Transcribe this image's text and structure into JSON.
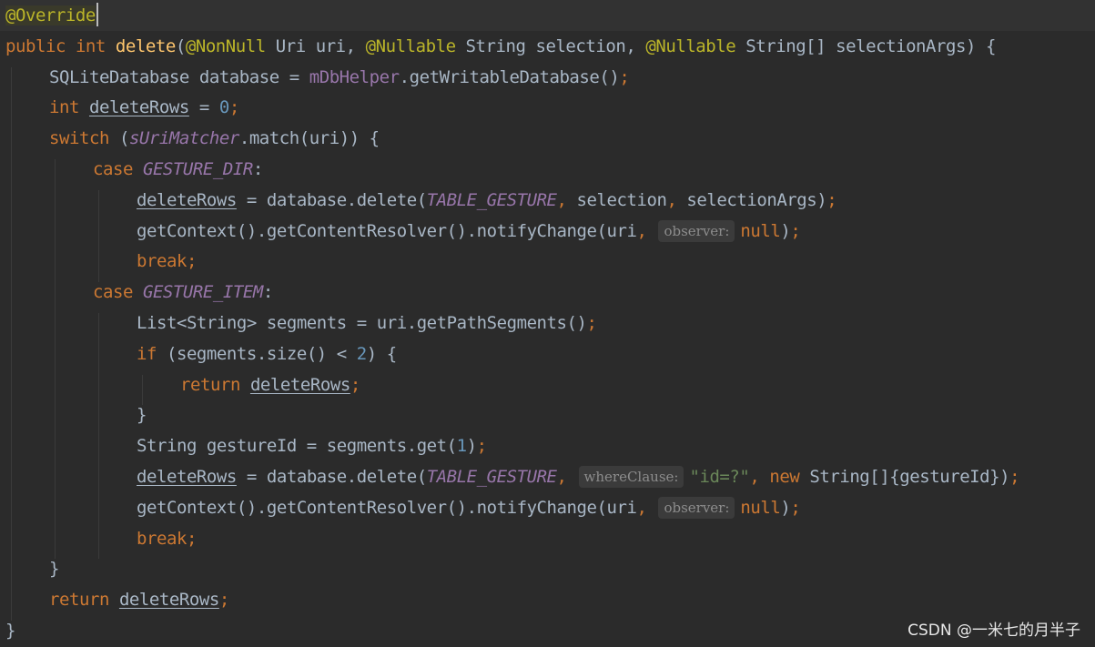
{
  "theme": {
    "background": "#2b2b2b",
    "current_line": "#323232",
    "default_text": "#a9b7c6",
    "keyword": "#cc7832",
    "annotation": "#bbb529",
    "method": "#ffc66d",
    "field": "#9876aa",
    "number": "#6897bb",
    "string": "#6a8759",
    "hint_bg": "#3b3b3b",
    "hint_text": "#8c8c8c"
  },
  "code_lines": [
    {
      "indent": 0,
      "current": true,
      "tokens": [
        {
          "t": "@Override",
          "c": "ann-hl"
        },
        {
          "caret": true
        }
      ]
    },
    {
      "indent": 0,
      "tokens": [
        {
          "t": "public ",
          "c": "kw"
        },
        {
          "t": "int ",
          "c": "kw"
        },
        {
          "t": "delete",
          "c": "fn"
        },
        {
          "t": "("
        },
        {
          "t": "@NonNull ",
          "c": "ann"
        },
        {
          "t": "Uri uri, "
        },
        {
          "t": "@Nullable ",
          "c": "ann"
        },
        {
          "t": "String selection, "
        },
        {
          "t": "@Nullable ",
          "c": "ann"
        },
        {
          "t": "String[] selectionArgs) {"
        }
      ]
    },
    {
      "indent": 1,
      "tokens": [
        {
          "t": "SQLiteDatabase database = "
        },
        {
          "t": "mDbHelper",
          "c": "fld"
        },
        {
          "t": ".getWritableDatabase()"
        },
        {
          "t": ";",
          "c": "kw"
        }
      ]
    },
    {
      "indent": 1,
      "tokens": [
        {
          "t": "int ",
          "c": "kw"
        },
        {
          "t": "deleteRows",
          "c": "uline"
        },
        {
          "t": " = "
        },
        {
          "t": "0",
          "c": "num"
        },
        {
          "t": ";",
          "c": "kw"
        }
      ]
    },
    {
      "indent": 1,
      "tokens": [
        {
          "t": "switch ",
          "c": "kw"
        },
        {
          "t": "("
        },
        {
          "t": "sUriMatcher",
          "c": "sfld"
        },
        {
          "t": ".match(uri)) {"
        }
      ]
    },
    {
      "indent": 2,
      "tokens": [
        {
          "t": "case ",
          "c": "kw"
        },
        {
          "t": "GESTURE_DIR",
          "c": "sfld"
        },
        {
          "t": ":"
        }
      ]
    },
    {
      "indent": 3,
      "tokens": [
        {
          "t": "deleteRows",
          "c": "uline"
        },
        {
          "t": " = database.delete("
        },
        {
          "t": "TABLE_GESTURE",
          "c": "sfld"
        },
        {
          "t": ", ",
          "c": "kw"
        },
        {
          "t": "selection"
        },
        {
          "t": ", ",
          "c": "kw"
        },
        {
          "t": "selectionArgs)"
        },
        {
          "t": ";",
          "c": "kw"
        }
      ]
    },
    {
      "indent": 3,
      "tokens": [
        {
          "t": "getContext().getContentResolver().notifyChange(uri"
        },
        {
          "t": ", ",
          "c": "kw"
        },
        {
          "hint": "observer:"
        },
        {
          "t": "null",
          "c": "kw"
        },
        {
          "t": ")"
        },
        {
          "t": ";",
          "c": "kw"
        }
      ]
    },
    {
      "indent": 3,
      "tokens": [
        {
          "t": "break;",
          "c": "kw"
        }
      ]
    },
    {
      "indent": 2,
      "tokens": [
        {
          "t": "case ",
          "c": "kw"
        },
        {
          "t": "GESTURE_ITEM",
          "c": "sfld"
        },
        {
          "t": ":"
        }
      ]
    },
    {
      "indent": 3,
      "tokens": [
        {
          "t": "List<String> segments = uri.getPathSegments()"
        },
        {
          "t": ";",
          "c": "kw"
        }
      ]
    },
    {
      "indent": 3,
      "tokens": [
        {
          "t": "if ",
          "c": "kw"
        },
        {
          "t": "(segments.size() < "
        },
        {
          "t": "2",
          "c": "num"
        },
        {
          "t": ") {"
        }
      ]
    },
    {
      "indent": 4,
      "tokens": [
        {
          "t": "return ",
          "c": "kw"
        },
        {
          "t": "deleteRows",
          "c": "uline"
        },
        {
          "t": ";",
          "c": "kw"
        }
      ]
    },
    {
      "indent": 3,
      "tokens": [
        {
          "t": "}"
        }
      ]
    },
    {
      "indent": 3,
      "tokens": [
        {
          "t": "String gestureId = segments.get("
        },
        {
          "t": "1",
          "c": "num"
        },
        {
          "t": ")"
        },
        {
          "t": ";",
          "c": "kw"
        }
      ]
    },
    {
      "indent": 3,
      "tokens": [
        {
          "t": "deleteRows",
          "c": "uline"
        },
        {
          "t": " = database.delete("
        },
        {
          "t": "TABLE_GESTURE",
          "c": "sfld"
        },
        {
          "t": ", ",
          "c": "kw"
        },
        {
          "hint": "whereClause:"
        },
        {
          "t": "\"id=?\"",
          "c": "str"
        },
        {
          "t": ", ",
          "c": "kw"
        },
        {
          "t": "new ",
          "c": "kw"
        },
        {
          "t": "String[]{gestureId})"
        },
        {
          "t": ";",
          "c": "kw"
        }
      ]
    },
    {
      "indent": 3,
      "tokens": [
        {
          "t": "getContext().getContentResolver().notifyChange(uri"
        },
        {
          "t": ", ",
          "c": "kw"
        },
        {
          "hint": "observer:"
        },
        {
          "t": "null",
          "c": "kw"
        },
        {
          "t": ")"
        },
        {
          "t": ";",
          "c": "kw"
        }
      ]
    },
    {
      "indent": 3,
      "tokens": [
        {
          "t": "break;",
          "c": "kw"
        }
      ]
    },
    {
      "indent": 1,
      "tokens": [
        {
          "t": "}"
        }
      ]
    },
    {
      "indent": 1,
      "tokens": [
        {
          "t": "return ",
          "c": "kw"
        },
        {
          "t": "deleteRows",
          "c": "uline"
        },
        {
          "t": ";",
          "c": "kw"
        }
      ]
    },
    {
      "indent": 0,
      "tokens": [
        {
          "t": "}"
        }
      ]
    }
  ],
  "watermark": "CSDN @一米七的月半子"
}
